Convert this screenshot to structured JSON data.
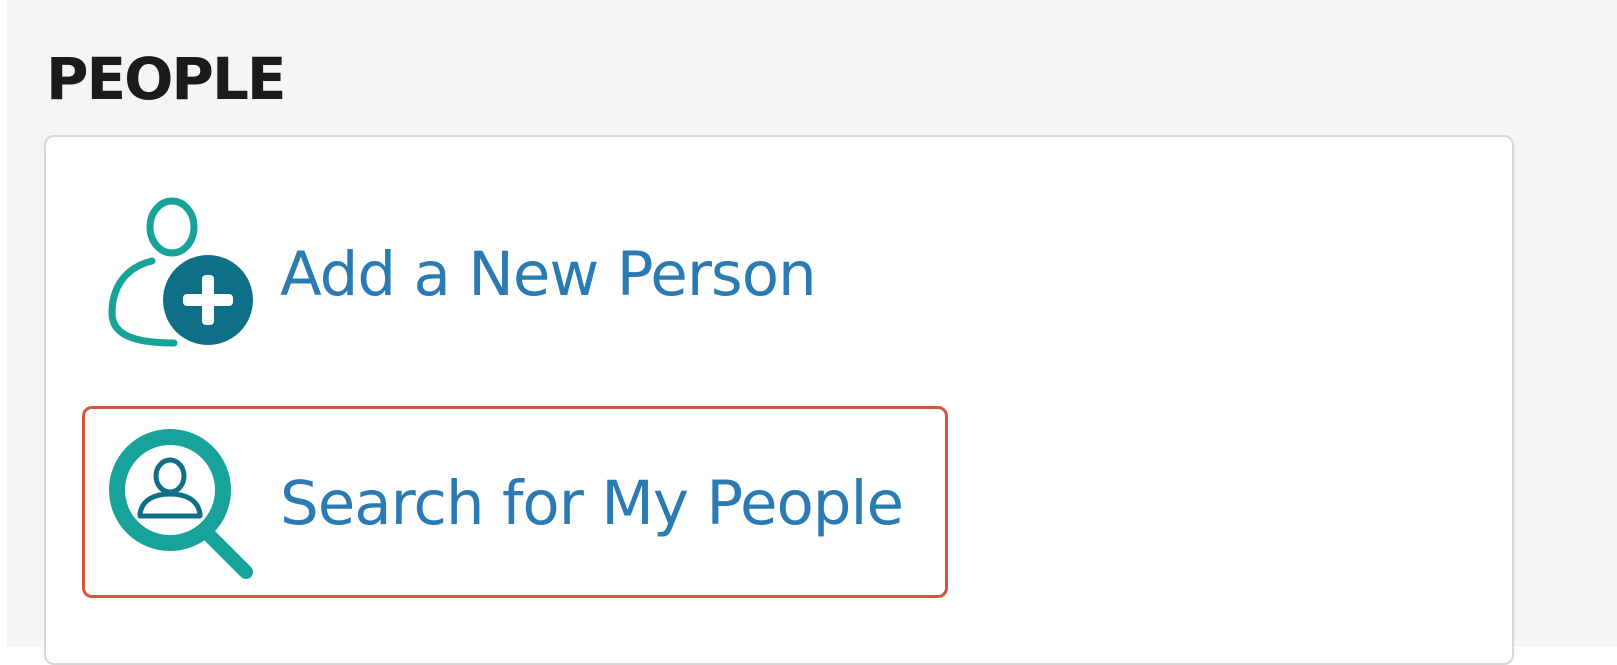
{
  "section": {
    "title": "PEOPLE"
  },
  "actions": [
    {
      "label": "Add a New Person",
      "icon": "add-person-icon"
    },
    {
      "label": "Search for My People",
      "icon": "person-search-icon"
    }
  ],
  "colors": {
    "teal": "#17a39a",
    "dark_teal": "#0f6f86",
    "link_blue": "#2a7bb3",
    "highlight_red": "#d9533f"
  }
}
